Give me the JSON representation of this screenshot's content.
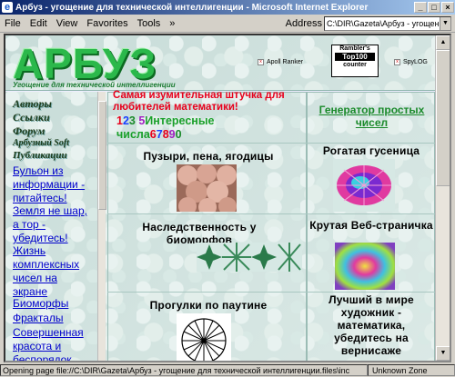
{
  "window": {
    "title": "Арбуз - угощение для технической интеллигенции - Microsoft Internet Explorer"
  },
  "menu": [
    "File",
    "Edit",
    "View",
    "Favorites",
    "Tools"
  ],
  "address": {
    "label": "Address",
    "value": "C:\\DIR\\Gazeta\\Арбуз - угощен"
  },
  "header": {
    "logo": "АРБУЗ",
    "subtitle": "Угощение для технической интеллигенции",
    "ad_left": "Apoll Ranker",
    "rambler_top": "Rambler's",
    "rambler_mid": "Top100",
    "rambler_bot": "counter",
    "ad_right": "SpyLOG"
  },
  "sidebar": {
    "fancy": [
      "Авторы",
      "Ссылки",
      "Форум",
      "Арбузный Soft",
      "Публикации"
    ],
    "links": [
      "Бульон из информации - питайтесь!",
      "Земля не шар, а тор - убедитесь!",
      "Жизнь комплексных чисел на экране",
      "Биоморфы",
      "Фракталы",
      "Совершенная красота и беспорядок"
    ]
  },
  "main": {
    "headline": "Самая изумительная штучка для любителей математики!",
    "numbers_word1": "Интересные",
    "numbers_word2": "числа",
    "prime_link": "Генератор простых чисел",
    "cell_bubbles": "Пузыри, пена, ягодицы",
    "cell_caterpillar": "Рогатая гусеница",
    "cell_biomorph": "Наследственность у биоморфов",
    "cell_web": "Крутая Веб-страничка",
    "cell_net": "Прогулки по паутине",
    "cell_artist": "Лучший в мире художник - математика, убедитесь на вернисаже"
  },
  "status": {
    "message": "Opening page file://C:\\DIR\\Gazeta\\Арбуз - угощение для технической интеллигенции.files\\inc",
    "zone": "Unknown Zone"
  }
}
